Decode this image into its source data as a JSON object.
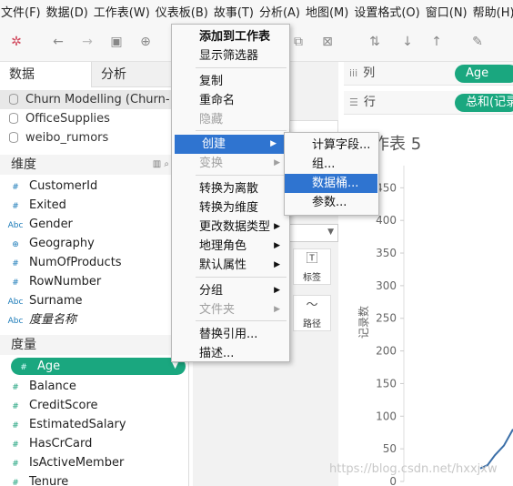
{
  "menubar": [
    "文件(F)",
    "数据(D)",
    "工作表(W)",
    "仪表板(B)",
    "故事(T)",
    "分析(A)",
    "地图(M)",
    "设置格式(O)",
    "窗口(N)",
    "帮助(H)"
  ],
  "left_tabs": {
    "data": "数据",
    "analytics": "分析"
  },
  "datasources": [
    "Churn Modelling (Churn-...",
    "OfficeSupplies",
    "weibo_rumors"
  ],
  "dimensions": {
    "header": "维度",
    "fields": [
      {
        "type": "#",
        "label": "CustomerId"
      },
      {
        "type": "#",
        "label": "Exited"
      },
      {
        "type": "Abc",
        "label": "Gender"
      },
      {
        "type": "⊕",
        "label": "Geography"
      },
      {
        "type": "#",
        "label": "NumOfProducts"
      },
      {
        "type": "#",
        "label": "RowNumber"
      },
      {
        "type": "Abc",
        "label": "Surname"
      },
      {
        "type": "Abc",
        "label": "度量名称"
      }
    ]
  },
  "measures": {
    "header": "度量",
    "fields": [
      {
        "type": "#",
        "label": "Age"
      },
      {
        "type": "#",
        "label": "Balance"
      },
      {
        "type": "#",
        "label": "CreditScore"
      },
      {
        "type": "#",
        "label": "EstimatedSalary"
      },
      {
        "type": "#",
        "label": "HasCrCard"
      },
      {
        "type": "#",
        "label": "IsActiveMember"
      },
      {
        "type": "#",
        "label": "Tenure"
      }
    ]
  },
  "marks_card": {
    "label_button": "标签",
    "path_button": "路径"
  },
  "shelves": {
    "columns_label": "列",
    "columns_pill": "Age",
    "rows_label": "行",
    "rows_pill": "总和(记录数)"
  },
  "chart": {
    "title": "作表 5",
    "ylabel": "记录数"
  },
  "chart_data": {
    "type": "line",
    "title": "作表 5",
    "ylabel": "记录数",
    "yticks": [
      0,
      50,
      100,
      150,
      200,
      250,
      300,
      350,
      400,
      450
    ],
    "ylim": [
      0,
      470
    ],
    "series": [
      {
        "values": [
          20,
          25,
          40,
          55,
          80
        ]
      }
    ]
  },
  "context_menu": {
    "items": [
      {
        "label": "添加到工作表",
        "bold": true
      },
      {
        "label": "显示筛选器"
      },
      {
        "label": "复制"
      },
      {
        "label": "重命名"
      },
      {
        "label": "隐藏",
        "disabled": true
      },
      {
        "label": "创建",
        "submenu": true,
        "highlighted": true
      },
      {
        "label": "变换",
        "submenu": true,
        "disabled": true
      },
      {
        "label": "转换为离散"
      },
      {
        "label": "转换为维度"
      },
      {
        "label": "更改数据类型",
        "submenu": true
      },
      {
        "label": "地理角色",
        "submenu": true
      },
      {
        "label": "默认属性",
        "submenu": true
      },
      {
        "label": "分组",
        "submenu": true
      },
      {
        "label": "文件夹",
        "submenu": true,
        "disabled": true
      },
      {
        "label": "替换引用..."
      },
      {
        "label": "描述..."
      }
    ]
  },
  "submenu": {
    "items": [
      {
        "label": "计算字段..."
      },
      {
        "label": "组..."
      },
      {
        "label": "数据桶...",
        "highlighted": true
      },
      {
        "label": "参数..."
      }
    ]
  },
  "watermark": "https://blog.csdn.net/hxxjxw",
  "colors": {
    "accent": "#1aa77f",
    "menu_highlight": "#2f74d0",
    "line": "#3b6fa8"
  }
}
